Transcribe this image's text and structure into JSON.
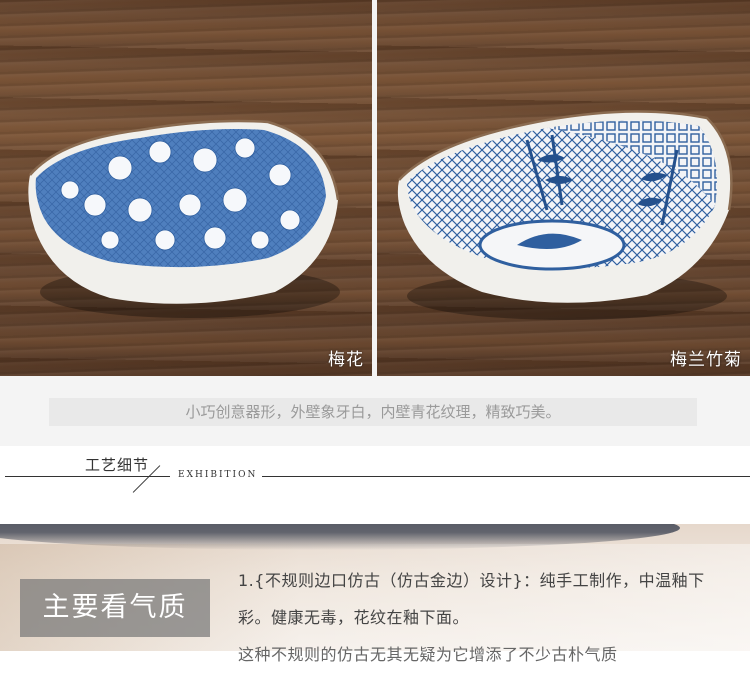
{
  "photos": {
    "left_caption": "梅花",
    "right_caption": "梅兰竹菊"
  },
  "tagline": "小巧创意器形，外壁象牙白，内壁青花纹理，精致巧美。",
  "section": {
    "title": "工艺细节",
    "subtitle": "EXHIBITION"
  },
  "detail": {
    "badge": "主要看气质",
    "lines": [
      "1.{不规则边口仿古（仿古金边）设计}：纯手工制作，中温釉下",
      "彩。健康无毒，花纹在釉下面。",
      "这种不规则的仿古无其无疑为它增添了不少古朴气质"
    ]
  },
  "colors": {
    "blue_pattern": "#2f5f9f",
    "glaze": "#f3f2ee",
    "wood": "#6b4a33"
  }
}
